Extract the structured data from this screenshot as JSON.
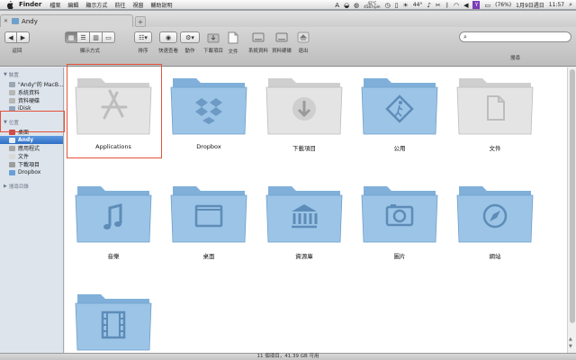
{
  "menubar": {
    "app": "Finder",
    "items": [
      "檔案",
      "編輯",
      "顯示方式",
      "前往",
      "視窗",
      "輔助說明"
    ],
    "temperature": "42°C",
    "fan_speed": "4587rpm",
    "weather": "44°",
    "battery": "(76%)",
    "date": "1月9日週日",
    "time": "11:57"
  },
  "window": {
    "tab_title": "Andy",
    "toolbar": {
      "back_label": "返回",
      "view_label": "顯示方式",
      "arrange_label": "排序",
      "quicklook_label": "快速查看",
      "action_label": "動作",
      "downloads_label": "下載項目",
      "documents_label": "文件",
      "sysinfo_label": "系統資料",
      "harddisk_label": "資料硬碟",
      "eject_label": "退出",
      "search_label": "搜尋"
    }
  },
  "sidebar": {
    "devices_header": "裝置",
    "devices": [
      "\"Andy\"的 MacB...",
      "系統資料",
      "資料硬碟",
      "iDisk"
    ],
    "places_header": "位置",
    "places": [
      "桌面",
      "Andy",
      "應用程式",
      "文件",
      "下載項目",
      "Dropbox"
    ],
    "search_header": "搜尋目錄"
  },
  "items": [
    {
      "label": "Applications",
      "icon": "applications-folder-icon"
    },
    {
      "label": "Dropbox",
      "icon": "dropbox-folder-icon"
    },
    {
      "label": "下載項目",
      "icon": "downloads-folder-icon"
    },
    {
      "label": "公用",
      "icon": "public-folder-icon"
    },
    {
      "label": "文件",
      "icon": "documents-folder-icon"
    },
    {
      "label": "音樂",
      "icon": "music-folder-icon"
    },
    {
      "label": "桌面",
      "icon": "desktop-folder-icon"
    },
    {
      "label": "資源庫",
      "icon": "library-folder-icon"
    },
    {
      "label": "圖片",
      "icon": "pictures-folder-icon"
    },
    {
      "label": "網站",
      "icon": "sites-folder-icon"
    },
    {
      "label": "",
      "icon": "movies-folder-icon"
    }
  ],
  "status": "11 個項目，41.39 GB 可用",
  "colors": {
    "highlight": "#e2523b",
    "selection": "#3a78cc",
    "folder": "#8bb8de"
  }
}
